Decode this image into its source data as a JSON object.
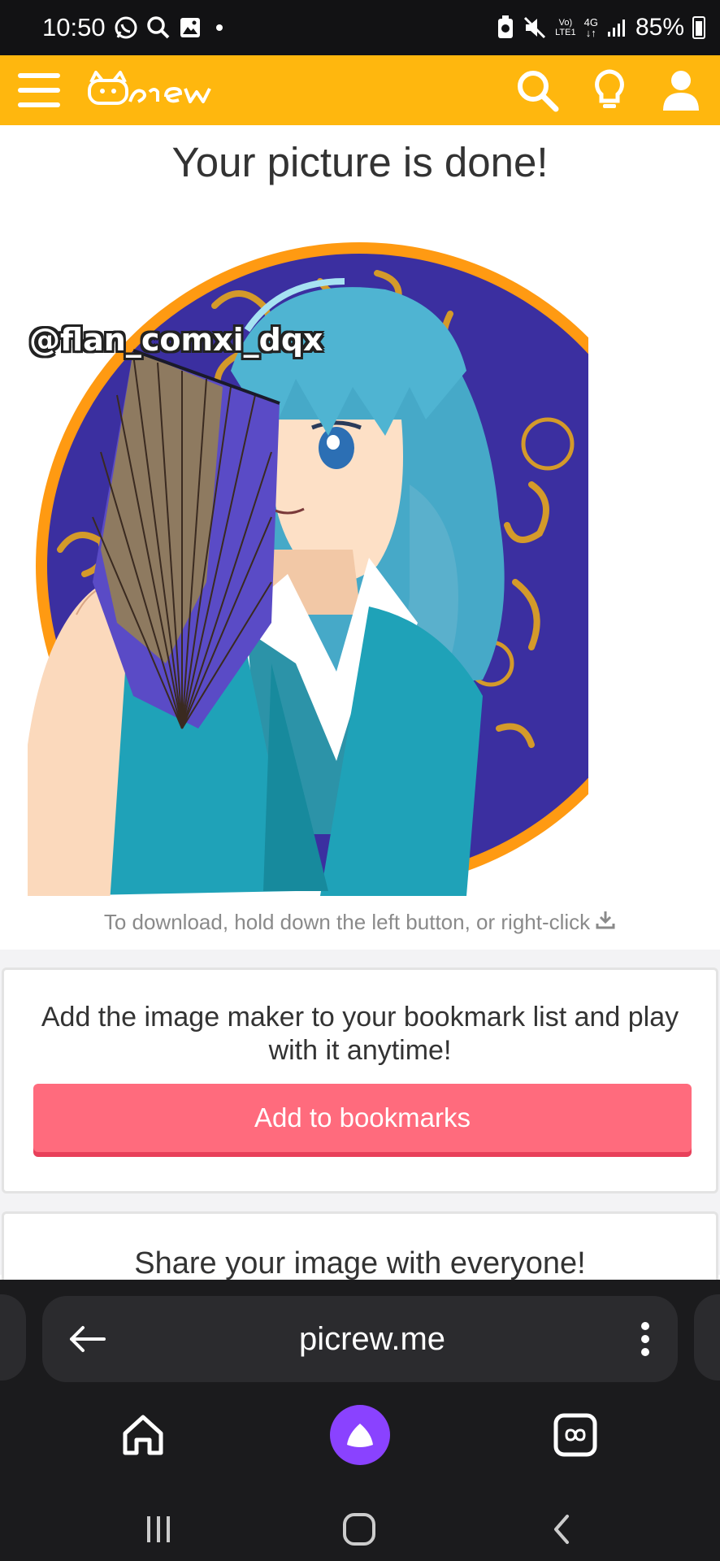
{
  "status_bar": {
    "time": "10:50",
    "battery": "85%",
    "network_label_top": "Vo)",
    "network_label_bottom": "LTE1",
    "network_gen": "4G"
  },
  "header": {
    "logo_text": "Picrew",
    "brand_color": "#ffb70e"
  },
  "main": {
    "title": "Your picture is done!",
    "watermark": "@flan_comxi_dqx",
    "download_hint": "To download, hold down the left button, or right-click"
  },
  "bookmark_card": {
    "text": "Add the image maker to your bookmark list and play with it anytime!",
    "button_label": "Add to bookmarks",
    "button_color": "#ff6b7d"
  },
  "share_card": {
    "text": "Share your image with everyone!"
  },
  "browser": {
    "url": "picrew.me"
  },
  "icons": [
    "menu-icon",
    "search-icon",
    "lightbulb-icon",
    "user-icon",
    "download-icon",
    "back-arrow-icon",
    "more-vert-icon",
    "home-icon",
    "alice-icon",
    "tabs-icon"
  ]
}
